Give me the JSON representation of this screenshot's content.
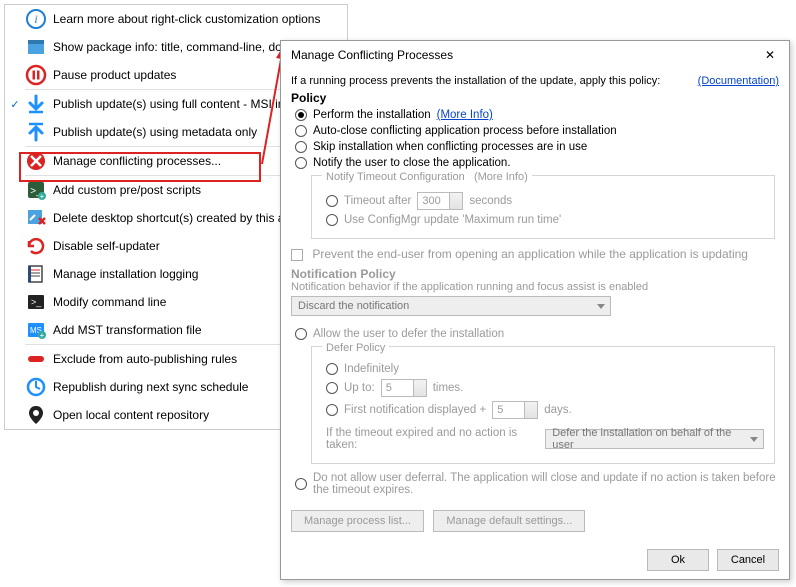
{
  "menu": {
    "items": [
      {
        "icon": "info",
        "label": "Learn more about right-click customization options",
        "checked": false
      },
      {
        "icon": "package",
        "label": "Show package info: title, command-line, dow",
        "checked": false
      },
      {
        "icon": "pause",
        "label": "Pause product updates",
        "checked": false
      },
      {
        "icon": "down-arrow",
        "label": "Publish update(s) using full content - MSI in",
        "checked": true
      },
      {
        "icon": "up-arrow",
        "label": "Publish update(s) using metadata only",
        "checked": false
      },
      {
        "icon": "stop",
        "label": "Manage conflicting processes...",
        "checked": false
      },
      {
        "icon": "script",
        "label": "Add custom pre/post scripts",
        "checked": false
      },
      {
        "icon": "delete-shortcut",
        "label": "Delete desktop shortcut(s) created by this ap",
        "checked": false
      },
      {
        "icon": "refresh-off",
        "label": "Disable self-updater",
        "checked": false
      },
      {
        "icon": "log",
        "label": "Manage installation logging",
        "checked": false
      },
      {
        "icon": "terminal",
        "label": "Modify command line",
        "checked": false
      },
      {
        "icon": "mst",
        "label": "Add MST transformation file",
        "checked": false
      },
      {
        "icon": "exclude",
        "label": "Exclude from auto-publishing rules",
        "checked": false
      },
      {
        "icon": "republish",
        "label": "Republish during next sync schedule",
        "checked": false
      },
      {
        "icon": "location",
        "label": "Open local content repository",
        "checked": false
      }
    ],
    "separators_after": [
      2,
      4,
      5,
      11
    ]
  },
  "dialog": {
    "title": "Manage Conflicting Processes",
    "intro": "If a running process prevents the installation of the update, apply this policy:",
    "doc_link": "(Documentation)",
    "policy_label": "Policy",
    "more_info": "(More Info)",
    "radios": [
      "Perform the installation",
      "Auto-close conflicting application process before installation",
      "Skip installation when conflicting processes are in use",
      "Notify the user to close the application."
    ],
    "selected_radio": 0,
    "notify_group": {
      "title": "Notify Timeout Configuration",
      "more_info": "(More Info)",
      "timeout_label_pre": "Timeout after",
      "timeout_value": "300",
      "timeout_label_post": "seconds",
      "cfgmgr_label": "Use ConfigMgr update 'Maximum run time'"
    },
    "prevent_label": "Prevent the end-user from opening an application while the application is updating",
    "notif_policy_title": "Notification Policy",
    "notif_policy_sub": "Notification behavior if the application running and focus assist is enabled",
    "notif_select": "Discard the notification",
    "allow_defer": "Allow the user to defer the installation",
    "defer_group": {
      "title": "Defer Policy",
      "indef": "Indefinitely",
      "upto_pre": "Up to:",
      "upto_val": "5",
      "upto_post": "times.",
      "first_pre": "First notification displayed +",
      "first_val": "5",
      "first_post": "days.",
      "timeout_action_label": "If the timeout expired and no action is taken:",
      "timeout_action_select": "Defer the installation on behalf of the user"
    },
    "no_defer": "Do not allow user deferral. The application will close and update if no action is taken before the timeout expires.",
    "btn_manage_list": "Manage process list...",
    "btn_manage_defaults": "Manage default settings...",
    "btn_ok": "Ok",
    "btn_cancel": "Cancel"
  }
}
